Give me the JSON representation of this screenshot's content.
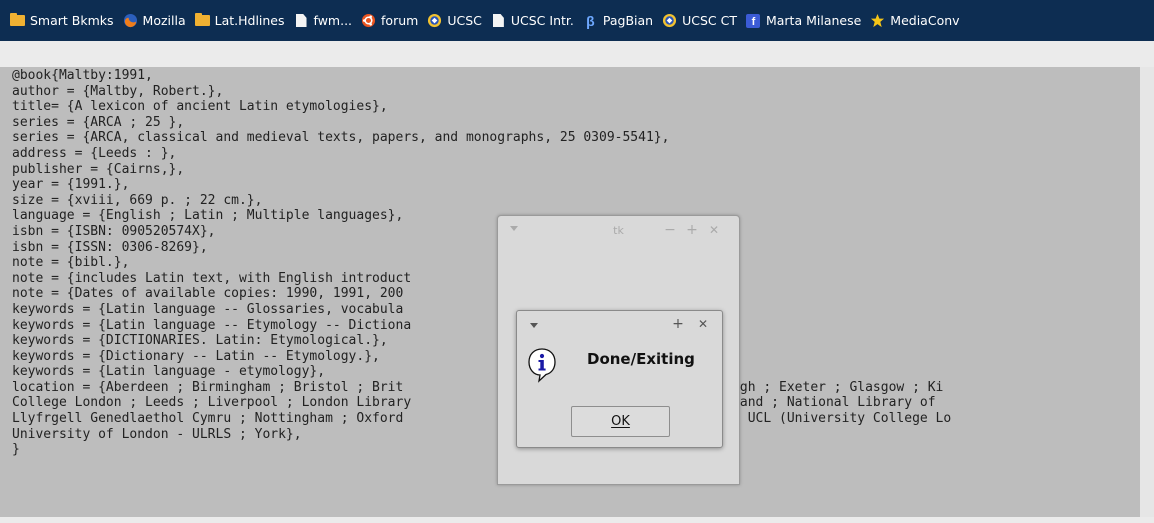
{
  "bookmarks": [
    {
      "label": "Smart Bkmks",
      "icon": "folder-icon"
    },
    {
      "label": "Mozilla",
      "icon": "firefox-icon"
    },
    {
      "label": "Lat.Hdlines",
      "icon": "folder-icon"
    },
    {
      "label": "fwm...",
      "icon": "page-icon"
    },
    {
      "label": "forum",
      "icon": "ubuntu-icon"
    },
    {
      "label": "UCSC",
      "icon": "globe-icon"
    },
    {
      "label": "UCSC Intr.",
      "icon": "page-icon"
    },
    {
      "label": "PagBian",
      "icon": "beta-icon"
    },
    {
      "label": "UCSC CT",
      "icon": "globe-icon"
    },
    {
      "label": "Marta Milanese",
      "icon": "facebook-icon"
    },
    {
      "label": "MediaConv",
      "icon": "star-icon"
    }
  ],
  "record_lines": [
    "@book{Maltby:1991,",
    "author = {Maltby, Robert.},",
    "title= {A lexicon of ancient Latin etymologies},",
    "series = {ARCA ; 25 },",
    "series = {ARCA, classical and medieval texts, papers, and monographs, 25 0309-5541},",
    "address = {Leeds : },",
    "publisher = {Cairns,},",
    "year = {1991.},",
    "size = {xviii, 669 p. ; 22 cm.},",
    "language = {English ; Latin ; Multiple languages},",
    "isbn = {ISBN: 090520574X},",
    "isbn = {ISSN: 0306-8269},",
    "note = {bibl.},",
    "note = {includes Latin text, with English introduct",
    "note = {Dates of available copies: 1990, 1991, 200",
    "keywords = {Latin language -- Glossaries, vocabula",
    "keywords = {Latin language -- Etymology -- Dictiona",
    "keywords = {DICTIONARIES. Latin: Etymological.},",
    "keywords = {Dictionary -- Latin -- Etymology.},",
    "keywords = {Latin language - etymology},",
    "location = {Aberdeen ; Birmingham ; Bristol ; Brit                           Durham ; Edinburgh ; Exeter ; Glasgow ; Ki",
    "College London ; Leeds ; Liverpool ; London Library                          Library of Scotland ; National Library of",
    "Llyfrgell Genedlaethol Cymru ; Nottingham ; Oxford                           College Dublin ; UCL (University College Lo",
    "University of London - ULRLS ; York},",
    "}"
  ],
  "tk_window": {
    "title": "tk",
    "minimize": "−",
    "maximize": "+",
    "close": "✕"
  },
  "dialog": {
    "message": "Done/Exiting",
    "ok_label": "OK",
    "maximize": "+",
    "close": "✕",
    "icon": "info-icon"
  },
  "colors": {
    "bookmarks_bg": "#0d2d52",
    "content_bg": "#bdbdbd",
    "dialog_bg": "#d9d9d9",
    "info_blue": "#1a1aa6"
  }
}
